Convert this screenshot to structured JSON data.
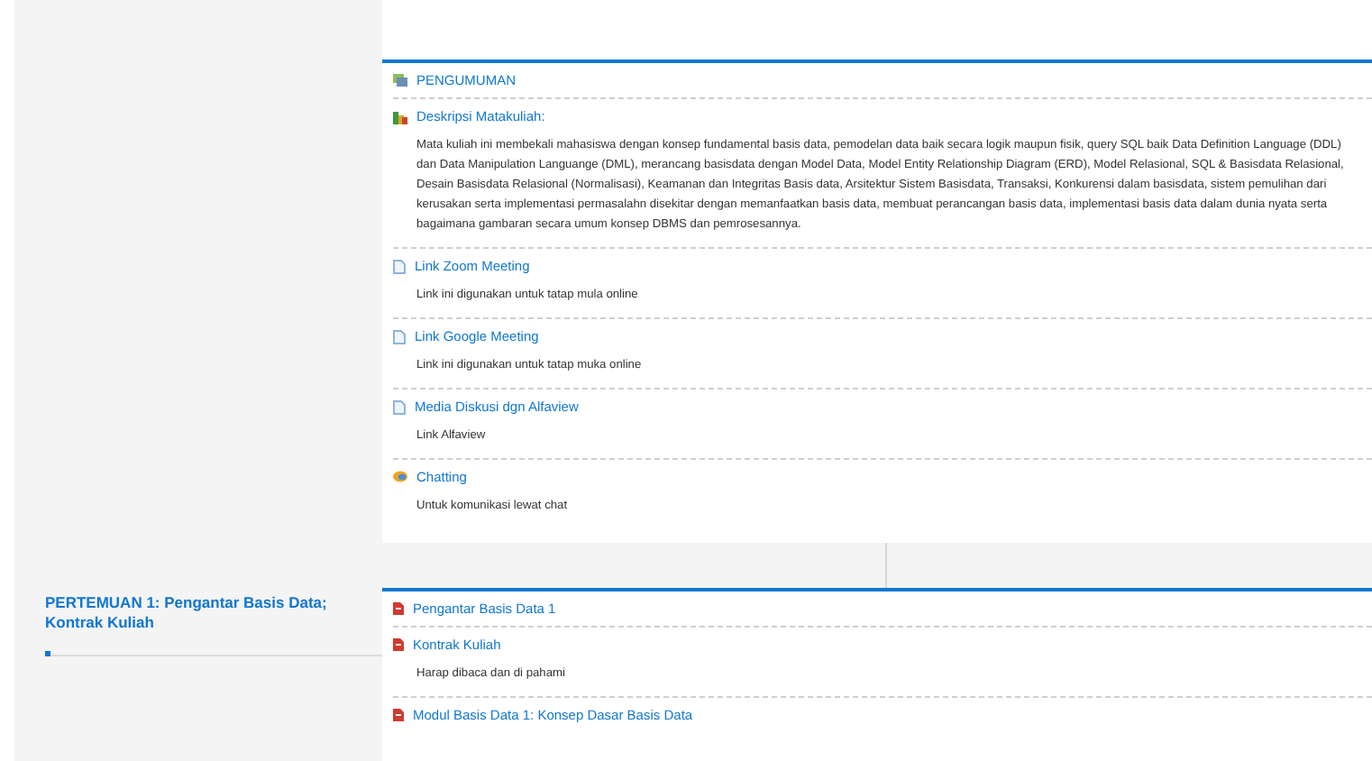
{
  "sections": [
    {
      "items": [
        {
          "kind": "forum",
          "title": "PENGUMUMAN"
        },
        {
          "kind": "label",
          "title": "Deskripsi Matakuliah:",
          "description": "Mata kuliah ini membekali mahasiswa dengan konsep fundamental basis data, pemodelan data baik secara logik maupun fisik, query SQL baik Data Definition Language (DDL) dan Data Manipulation Languange (DML), merancang basisdata dengan Model Data, Model Entity Relationship Diagram (ERD), Model Relasional, SQL & Basisdata Relasional, Desain Basisdata Relasional (Normalisasi), Keamanan dan Integritas Basis data, Arsitektur Sistem Basisdata, Transaksi, Konkurensi dalam basisdata, sistem pemulihan dari kerusakan serta implementasi permasalahn disekitar dengan memanfaatkan basis data, membuat perancangan basis data, implementasi basis data dalam dunia nyata serta bagaimana gambaran secara umum konsep DBMS dan pemrosesannya."
        },
        {
          "kind": "page",
          "title": "Link Zoom Meeting",
          "description": "Link ini digunakan untuk tatap mula online"
        },
        {
          "kind": "page",
          "title": "Link Google Meeting",
          "description": "Link ini digunakan untuk tatap muka online"
        },
        {
          "kind": "page",
          "title": "Media Diskusi dgn Alfaview",
          "description": "Link Alfaview"
        },
        {
          "kind": "chat",
          "title": "Chatting",
          "description": "Untuk komunikasi lewat chat"
        }
      ]
    },
    {
      "title": "PERTEMUAN 1: Pengantar Basis Data; Kontrak Kuliah",
      "items": [
        {
          "kind": "pdf",
          "title": "Pengantar Basis Data 1"
        },
        {
          "kind": "pdf",
          "title": "Kontrak Kuliah",
          "description": "Harap dibaca dan di pahami"
        },
        {
          "kind": "pdf",
          "title": "Modul Basis Data 1: Konsep Dasar Basis Data"
        }
      ]
    }
  ]
}
